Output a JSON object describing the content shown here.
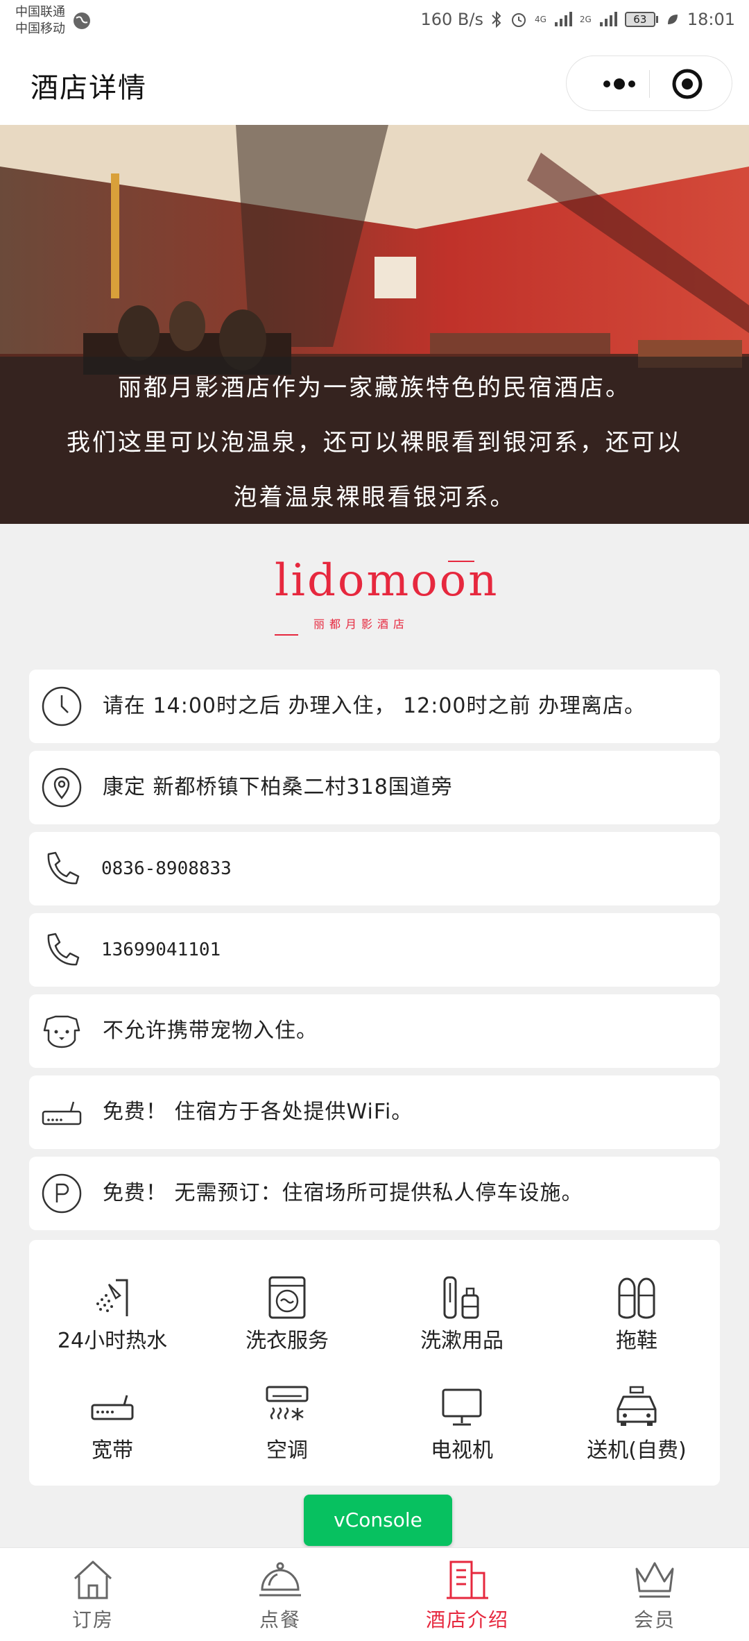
{
  "status_bar": {
    "carrier_1": "中国联通",
    "carrier_2": "中国移动",
    "net_speed": "160 B/s",
    "net_1": "4G",
    "net_2": "2G",
    "battery": "63",
    "time": "18:01"
  },
  "nav": {
    "title": "酒店详情"
  },
  "hero": {
    "line_1": "丽都月影酒店作为一家藏族特色的民宿酒店。",
    "line_2": "我们这里可以泡温泉，还可以裸眼看到银河系，还可以",
    "line_3": "泡着温泉裸眼看银河系。"
  },
  "logo": {
    "name": "lidomoon",
    "subtitle": "丽都月影酒店"
  },
  "info": {
    "checkin": "请在 14:00时之后 办理入住， 12:00时之前 办理离店。",
    "address": "康定 新都桥镇下柏桑二村318国道旁",
    "phone_1": "0836-8908833",
    "phone_2": "13699041101",
    "pets": "不允许携带宠物入住。",
    "wifi": "免费！ 住宿方于各处提供WiFi。",
    "parking": "免费！ 无需预订：住宿场所可提供私人停车设施。"
  },
  "amenities": [
    {
      "label": "24小时热水",
      "icon": "shower-icon"
    },
    {
      "label": "洗衣服务",
      "icon": "washing-machine-icon"
    },
    {
      "label": "洗漱用品",
      "icon": "toiletries-icon"
    },
    {
      "label": "拖鞋",
      "icon": "slippers-icon"
    },
    {
      "label": "宽带",
      "icon": "router-icon"
    },
    {
      "label": "空调",
      "icon": "air-conditioner-icon"
    },
    {
      "label": "电视机",
      "icon": "tv-icon"
    },
    {
      "label": "送机(自费)",
      "icon": "car-icon"
    }
  ],
  "vconsole": {
    "label": "vConsole"
  },
  "tabs": [
    {
      "label": "订房",
      "icon": "home-icon",
      "active": false
    },
    {
      "label": "点餐",
      "icon": "dining-icon",
      "active": false
    },
    {
      "label": "酒店介绍",
      "icon": "building-icon",
      "active": true
    },
    {
      "label": "会员",
      "icon": "crown-icon",
      "active": false
    }
  ],
  "colors": {
    "accent": "#e6283e",
    "vconsole": "#07c160",
    "background": "#f0f0f0"
  }
}
